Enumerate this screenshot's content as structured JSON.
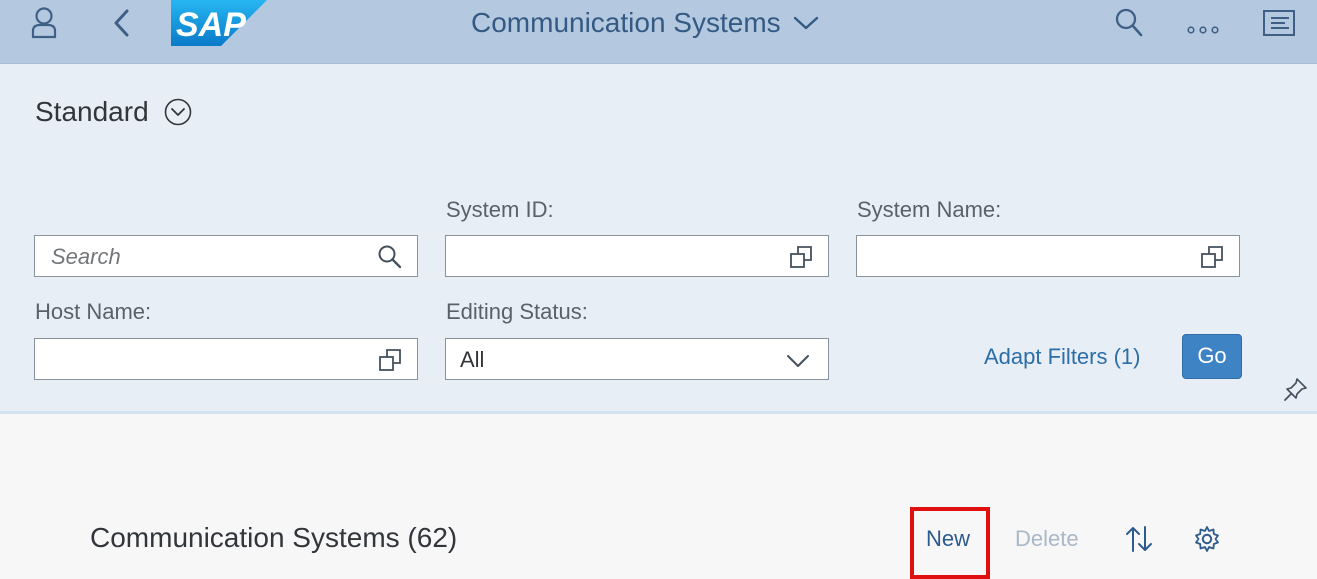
{
  "shell": {
    "title": "Communication Systems",
    "logo_text": "SAP",
    "icons": [
      "user-icon",
      "back-icon",
      "search-icon",
      "overflow-icon",
      "notifications-icon"
    ]
  },
  "filter_bar": {
    "variant": "Standard",
    "search": {
      "placeholder": "Search"
    },
    "system_id": {
      "label": "System ID:",
      "value": ""
    },
    "system_name": {
      "label": "System Name:",
      "value": ""
    },
    "host_name": {
      "label": "Host Name:",
      "value": ""
    },
    "editing_status": {
      "label": "Editing Status:",
      "value": "All"
    },
    "adapt_filters": "Adapt Filters (1)",
    "go": "Go"
  },
  "table": {
    "title": "Communication Systems (62)",
    "new": "New",
    "delete": "Delete"
  },
  "colors": {
    "shell_bg": "#b4c9e0",
    "filter_bg": "#e7eef6",
    "accent": "#3e84c5",
    "highlight": "#e01010"
  }
}
